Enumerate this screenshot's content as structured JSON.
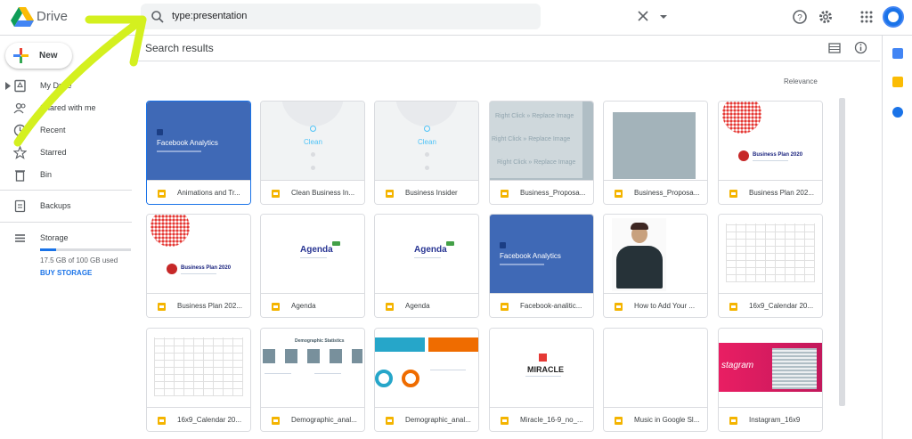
{
  "app": {
    "name": "Drive"
  },
  "search": {
    "value": "type:presentation"
  },
  "sidebar": {
    "new_label": "New",
    "items": [
      {
        "label": "My Drive",
        "icon": "my-drive-icon"
      },
      {
        "label": "Shared with me",
        "icon": "shared-icon"
      },
      {
        "label": "Recent",
        "icon": "clock-icon"
      },
      {
        "label": "Starred",
        "icon": "star-icon"
      },
      {
        "label": "Bin",
        "icon": "trash-icon"
      },
      {
        "label": "Backups",
        "icon": "backup-icon"
      },
      {
        "label": "Storage",
        "icon": "storage-icon"
      }
    ],
    "storage_text": "17.5 GB of 100 GB used",
    "storage_fraction": 0.175,
    "buy_storage": "BUY STORAGE"
  },
  "main": {
    "title": "Search results",
    "sort": "Relevance",
    "files": [
      {
        "name": "Animations and Tr...",
        "thumb": "facebook",
        "selected": true
      },
      {
        "name": "Clean Business In...",
        "thumb": "clean"
      },
      {
        "name": "Business Insider",
        "thumb": "clean"
      },
      {
        "name": "Business_Proposa...",
        "thumb": "replace"
      },
      {
        "name": "Business_Proposa...",
        "thumb": "graybox"
      },
      {
        "name": "Business Plan 202...",
        "thumb": "bizplan"
      },
      {
        "name": "Business Plan 202...",
        "thumb": "bizplan"
      },
      {
        "name": "Agenda",
        "thumb": "agenda"
      },
      {
        "name": "Agenda",
        "thumb": "agenda"
      },
      {
        "name": "Facebook-analitic...",
        "thumb": "facebook"
      },
      {
        "name": "How to Add Your ...",
        "thumb": "person"
      },
      {
        "name": "16x9_Calendar 20...",
        "thumb": "calendar"
      },
      {
        "name": "16x9_Calendar 20...",
        "thumb": "calendar"
      },
      {
        "name": "Demographic_anal...",
        "thumb": "demo1"
      },
      {
        "name": "Demographic_anal...",
        "thumb": "demo2"
      },
      {
        "name": "Miracle_16-9_no_...",
        "thumb": "miracle"
      },
      {
        "name": "Music in Google Sl...",
        "thumb": "blank"
      },
      {
        "name": "Instagram_16x9",
        "thumb": "instagram"
      }
    ],
    "thumb_text": {
      "facebook": "Facebook Analytics",
      "clean": "Clean",
      "replace": "Right Click » Replace Image",
      "bizplan": "Business Plan 2020",
      "agenda": "Agenda",
      "demographic": "Demographic Statistics",
      "miracle": "MIRACLE",
      "instagram": "stagram"
    }
  },
  "colors": {
    "accent": "#1a73e8",
    "slides": "#f4b400",
    "arrow": "#d4f01f"
  }
}
